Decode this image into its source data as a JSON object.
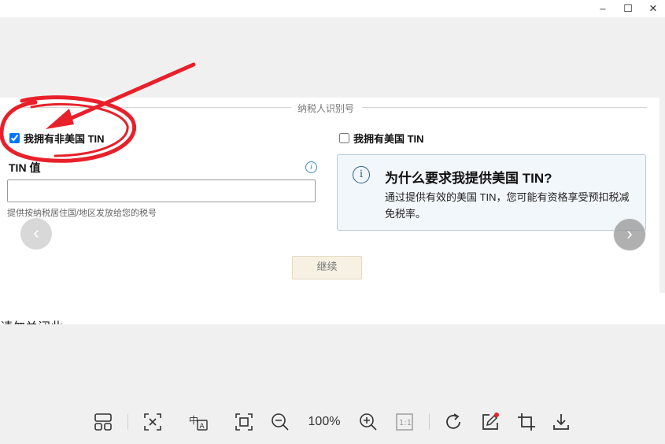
{
  "window": {
    "min_label": "–",
    "max_label": "☐",
    "close_label": "✕"
  },
  "section": {
    "title": "纳税人识别号"
  },
  "checkbox_non_us": {
    "label": "我拥有非美国 TIN",
    "checked": true
  },
  "checkbox_us": {
    "label": "我拥有美国 TIN",
    "checked": false
  },
  "tin": {
    "label": "TIN 值",
    "value": "",
    "hint": "提供按纳税居住国/地区发放给您的税号"
  },
  "info_box": {
    "icon_glyph": "i",
    "title": "为什么要求我提供美国 TIN?",
    "body": "通过提供有效的美国 TIN，您可能有资格享受预扣税减免税率。"
  },
  "carousel": {
    "prev_glyph": "‹",
    "next_glyph": "›"
  },
  "continue_button": {
    "label": "继续"
  },
  "cut_text": "请勿关闭此..",
  "toolbar": {
    "zoom_level": "100%",
    "actual_size_label": "1:1",
    "icons": [
      "layout-icon",
      "ocr-icon",
      "translate-icon",
      "fit-screen-icon",
      "zoom-out-icon",
      "zoom-in-icon",
      "actual-size-icon",
      "rotate-icon",
      "edit-icon",
      "crop-icon",
      "download-icon"
    ]
  },
  "colors": {
    "annotation_red": "#e8202a",
    "info_blue": "#3a86c8"
  }
}
